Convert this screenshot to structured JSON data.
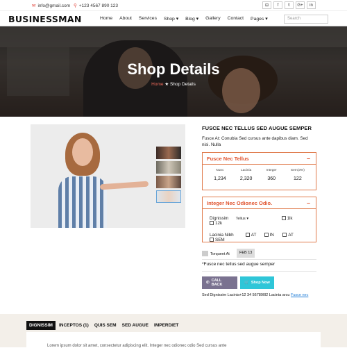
{
  "topbar": {
    "email": "info@gmail.com",
    "phone": "+123 4567 890 123"
  },
  "socials": [
    {
      "icon": "rss-icon",
      "glyph": "⊟"
    },
    {
      "icon": "facebook-icon",
      "glyph": "f"
    },
    {
      "icon": "twitter-icon",
      "glyph": "𝕥"
    },
    {
      "icon": "google-plus-icon",
      "glyph": "G+"
    },
    {
      "icon": "linkedin-icon",
      "glyph": "in"
    }
  ],
  "brand": "BUSINESSMAN",
  "menu": [
    "Home",
    "About",
    "Services",
    "Shop ▾",
    "Blog ▾",
    "Gallery",
    "Contact",
    "Pages ▾"
  ],
  "search": {
    "placeholder": "Search"
  },
  "hero": {
    "title": "Shop Details",
    "crumb_home": "Home",
    "crumb_current": "Shop Details"
  },
  "product": {
    "title": "FUSCE NEC TELLUS SED AUGUE SEMPER",
    "desc": "Fusce At: Conubia Sed cursus ante dapibus diam. Sed nisi. Nulla"
  },
  "box1": {
    "title": "Fusce Nec Tellus",
    "stats": [
      {
        "label": "Nunc",
        "value": "1,234"
      },
      {
        "label": "Lacinia",
        "value": "2,320"
      },
      {
        "label": "Integer",
        "value": "360"
      },
      {
        "label": "Sem(3%)",
        "value": "122"
      }
    ]
  },
  "box2": {
    "title": "Integer Nec Odionec Odio.",
    "row1": {
      "label": "Dignissim",
      "select": "Tellus ▾",
      "opts": [
        "1lk",
        "12k"
      ]
    },
    "row2": {
      "label": "Lacinia Nibh",
      "opts": [
        "AT",
        "IN",
        "AT",
        "SEM"
      ]
    }
  },
  "meta": {
    "label": "Torquent At",
    "date": "FEB 13"
  },
  "note": "*Fusce nec tellus sed augue semper",
  "buttons": {
    "back": "CALL BACK",
    "shop": "Shop Now"
  },
  "footinfo": {
    "text": "Sed Dignissim Lacinia+12 34 567890l2 Lacinia arcu ",
    "link": "Fusce nec"
  },
  "tabs": [
    "DIGNISSIM",
    "INCEPTOS (1)",
    "QUIS SEM",
    "SED AUGUE",
    "IMPERDIET"
  ],
  "tabtext": "Lorem ipsum dolor sit amet, consectetur adipiscing elit. Integer nec odionec odio Sed cursus ante",
  "colors": {
    "accent": "#e0542f",
    "link": "#1b7ad6",
    "callback": "#7a7290",
    "shop": "#2fc6d8"
  }
}
